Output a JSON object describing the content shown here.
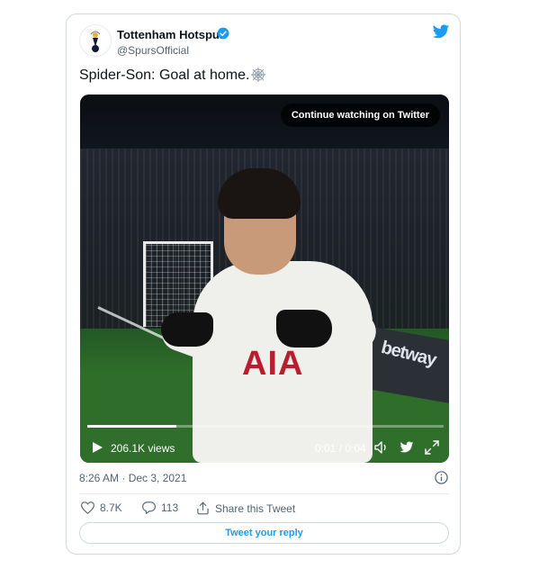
{
  "tweet": {
    "author_name": "Tottenham Hotspur",
    "handle": "@SpursOfficial",
    "text": "Spider-Son: Goal at home.",
    "timestamp": "8:26 AM · Dec 3, 2021"
  },
  "media": {
    "cta_label": "Continue watching on Twitter",
    "views": "206.1K views",
    "time": "0:01 / 0:04",
    "progress": 0.25,
    "shirt_text": "AIA",
    "board_text": "betway"
  },
  "actions": {
    "likes": "8.7K",
    "replies": "113",
    "share_label": "Share this Tweet"
  },
  "reply_label": "Tweet your reply",
  "colors": {
    "twitter_blue": "#1d9bf0",
    "secondary_text": "#536471",
    "border": "#cfd9de"
  }
}
